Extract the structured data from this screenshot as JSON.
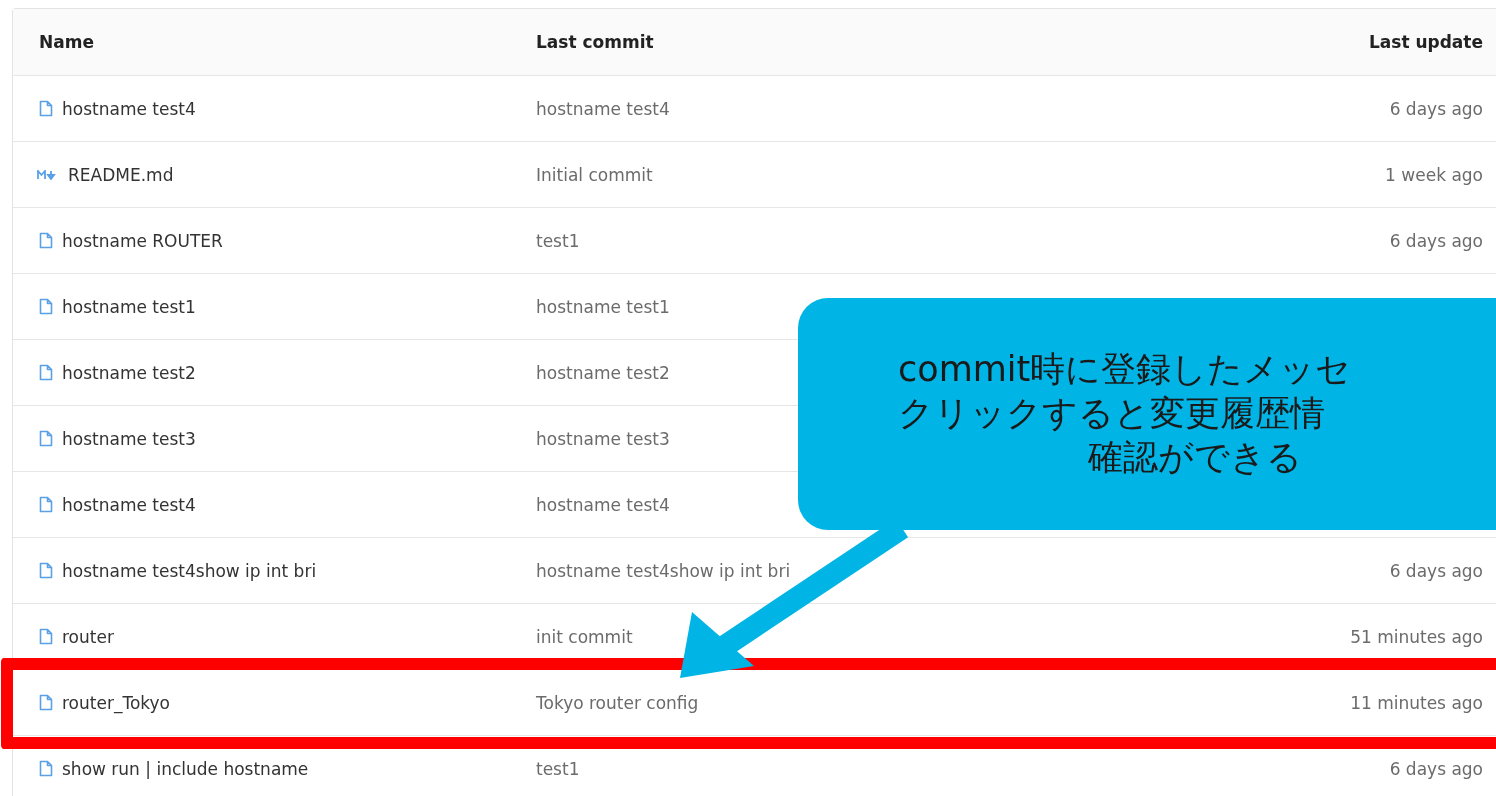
{
  "table": {
    "columns": [
      "Name",
      "Last commit",
      "Last update"
    ],
    "rows": [
      {
        "kind": "file",
        "name": "hostname test4",
        "last_commit": "hostname test4",
        "last_update": "6 days ago",
        "highlighted": false
      },
      {
        "kind": "markdown",
        "name": "README.md",
        "last_commit": "Initial commit",
        "last_update": "1 week ago",
        "highlighted": false
      },
      {
        "kind": "file",
        "name": "hostname ROUTER",
        "last_commit": "test1",
        "last_update": "6 days ago",
        "highlighted": false
      },
      {
        "kind": "file",
        "name": "hostname test1",
        "last_commit": "hostname test1",
        "highlighted": false
      },
      {
        "kind": "file",
        "name": "hostname test2",
        "last_commit": "hostname test2",
        "highlighted": false
      },
      {
        "kind": "file",
        "name": "hostname test3",
        "last_commit": "hostname test3",
        "highlighted": false
      },
      {
        "kind": "file",
        "name": "hostname test4",
        "last_commit": "hostname test4",
        "highlighted": false
      },
      {
        "kind": "file",
        "name": "hostname test4show ip int bri",
        "last_commit": "hostname test4show ip int bri",
        "last_update": "6 days ago",
        "highlighted": false
      },
      {
        "kind": "file",
        "name": "router",
        "last_commit": "init commit",
        "last_update": "51 minutes ago",
        "highlighted": false
      },
      {
        "kind": "file",
        "name": "router_Tokyo",
        "last_commit": "Tokyo router config",
        "last_update": "11 minutes ago",
        "highlighted": true
      },
      {
        "kind": "file",
        "name": "show run | include hostname",
        "last_commit": "test1",
        "last_update": "6 days ago",
        "highlighted": false
      }
    ]
  },
  "callout": {
    "lines": [
      "commit時に登録したメッセ",
      "クリックすると変更履歴情",
      "確認ができる"
    ]
  }
}
